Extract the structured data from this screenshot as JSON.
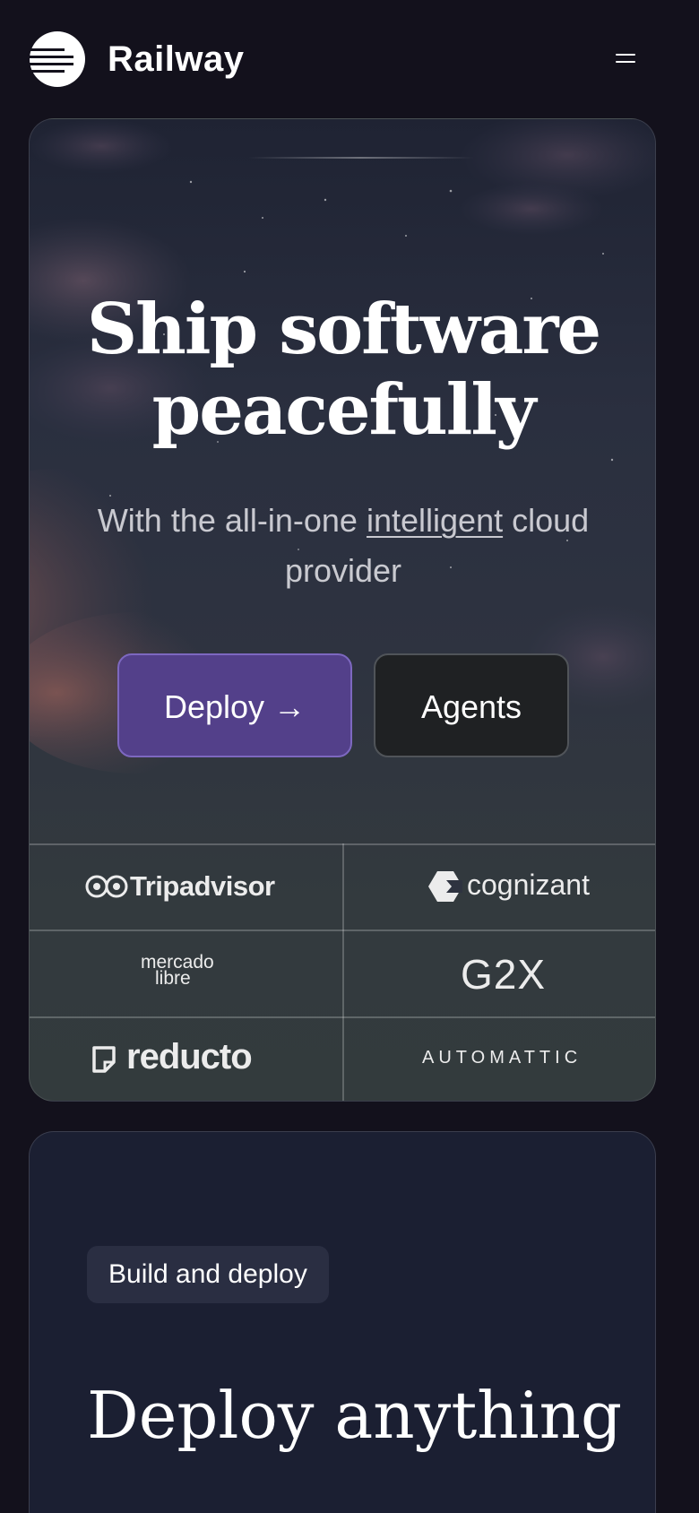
{
  "header": {
    "brand": "Railway",
    "logo_icon": "railway-logo-icon",
    "menu_icon": "hamburger-menu-icon"
  },
  "hero": {
    "title": "Ship software peacefully",
    "subtitle_before": "With the all-in-one",
    "subtitle_link": "intelligent",
    "subtitle_after": "cloud provider",
    "deploy_button": "Deploy →",
    "agents_button": "Agents"
  },
  "customers": {
    "tripadvisor": "Tripadvisor",
    "cognizant": "cognizant",
    "mercado_libre_line1": "mercado",
    "mercado_libre_line2": "libre",
    "g2x": "G2X",
    "reducto": "reducto",
    "automattic": "AUTOMATTIC"
  },
  "section": {
    "badge": "Build and deploy",
    "title": "Deploy anything"
  },
  "colors": {
    "background": "#13111c",
    "deploy_button": "#53408a",
    "agents_button": "#1f2123",
    "card": "#1b1f32"
  }
}
